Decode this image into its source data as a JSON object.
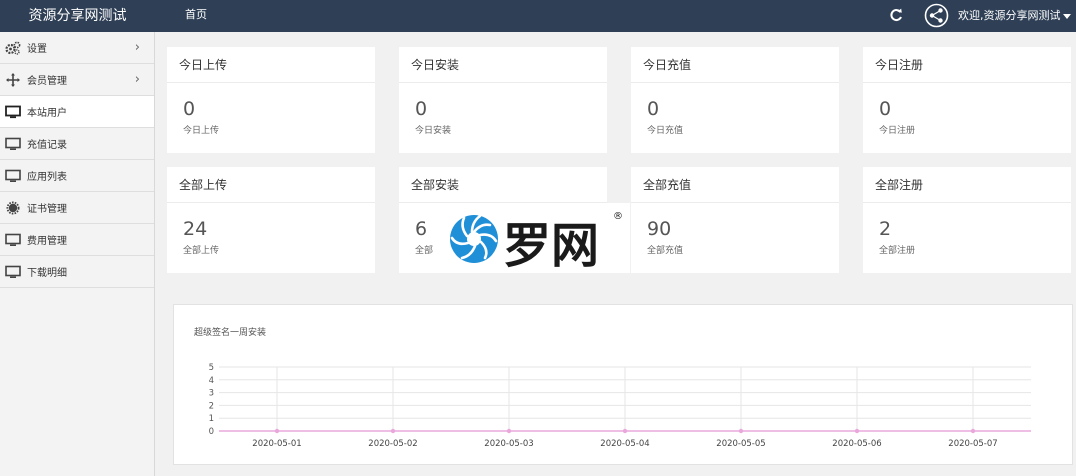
{
  "app": {
    "title": "资源分享网测试"
  },
  "header": {
    "home": "首页",
    "welcome": "欢迎,资源分享网测试"
  },
  "sidebar": {
    "items": [
      {
        "label": "设置",
        "icon": "gears-icon",
        "has_children": true
      },
      {
        "label": "会员管理",
        "icon": "move-icon",
        "has_children": true
      },
      {
        "label": "本站用户",
        "icon": "monitor-icon",
        "active": true
      },
      {
        "label": "充值记录",
        "icon": "monitor-icon"
      },
      {
        "label": "应用列表",
        "icon": "monitor-icon"
      },
      {
        "label": "证书管理",
        "icon": "gear-icon"
      },
      {
        "label": "费用管理",
        "icon": "monitor-icon"
      },
      {
        "label": "下载明细",
        "icon": "monitor-icon"
      }
    ]
  },
  "stats": {
    "today": [
      {
        "title": "今日上传",
        "value": "0",
        "label": "今日上传"
      },
      {
        "title": "今日安装",
        "value": "0",
        "label": "今日安装"
      },
      {
        "title": "今日充值",
        "value": "0",
        "label": "今日充值"
      },
      {
        "title": "今日注册",
        "value": "0",
        "label": "今日注册"
      }
    ],
    "total": [
      {
        "title": "全部上传",
        "value": "24",
        "label": "全部上传"
      },
      {
        "title": "全部安装",
        "value": "6",
        "label": "全部"
      },
      {
        "title": "全部充值",
        "value": "90",
        "label": "全部充值"
      },
      {
        "title": "全部注册",
        "value": "2",
        "label": "全部注册"
      }
    ]
  },
  "watermark": {
    "text": "罗网",
    "mark": "®"
  },
  "colors": {
    "topbar": "#2f4056",
    "line": "#e9a8dc",
    "logo_blue": "#1f8fd8"
  },
  "chart_data": {
    "type": "line",
    "title": "超级签名一周安装",
    "categories": [
      "2020-05-01",
      "2020-05-02",
      "2020-05-03",
      "2020-05-04",
      "2020-05-05",
      "2020-05-06",
      "2020-05-07"
    ],
    "values": [
      0,
      0,
      0,
      0,
      0,
      0,
      0
    ],
    "yticks": [
      "0",
      "1",
      "2",
      "3",
      "4",
      "5"
    ],
    "ylim": [
      0,
      5
    ],
    "grid": true
  }
}
